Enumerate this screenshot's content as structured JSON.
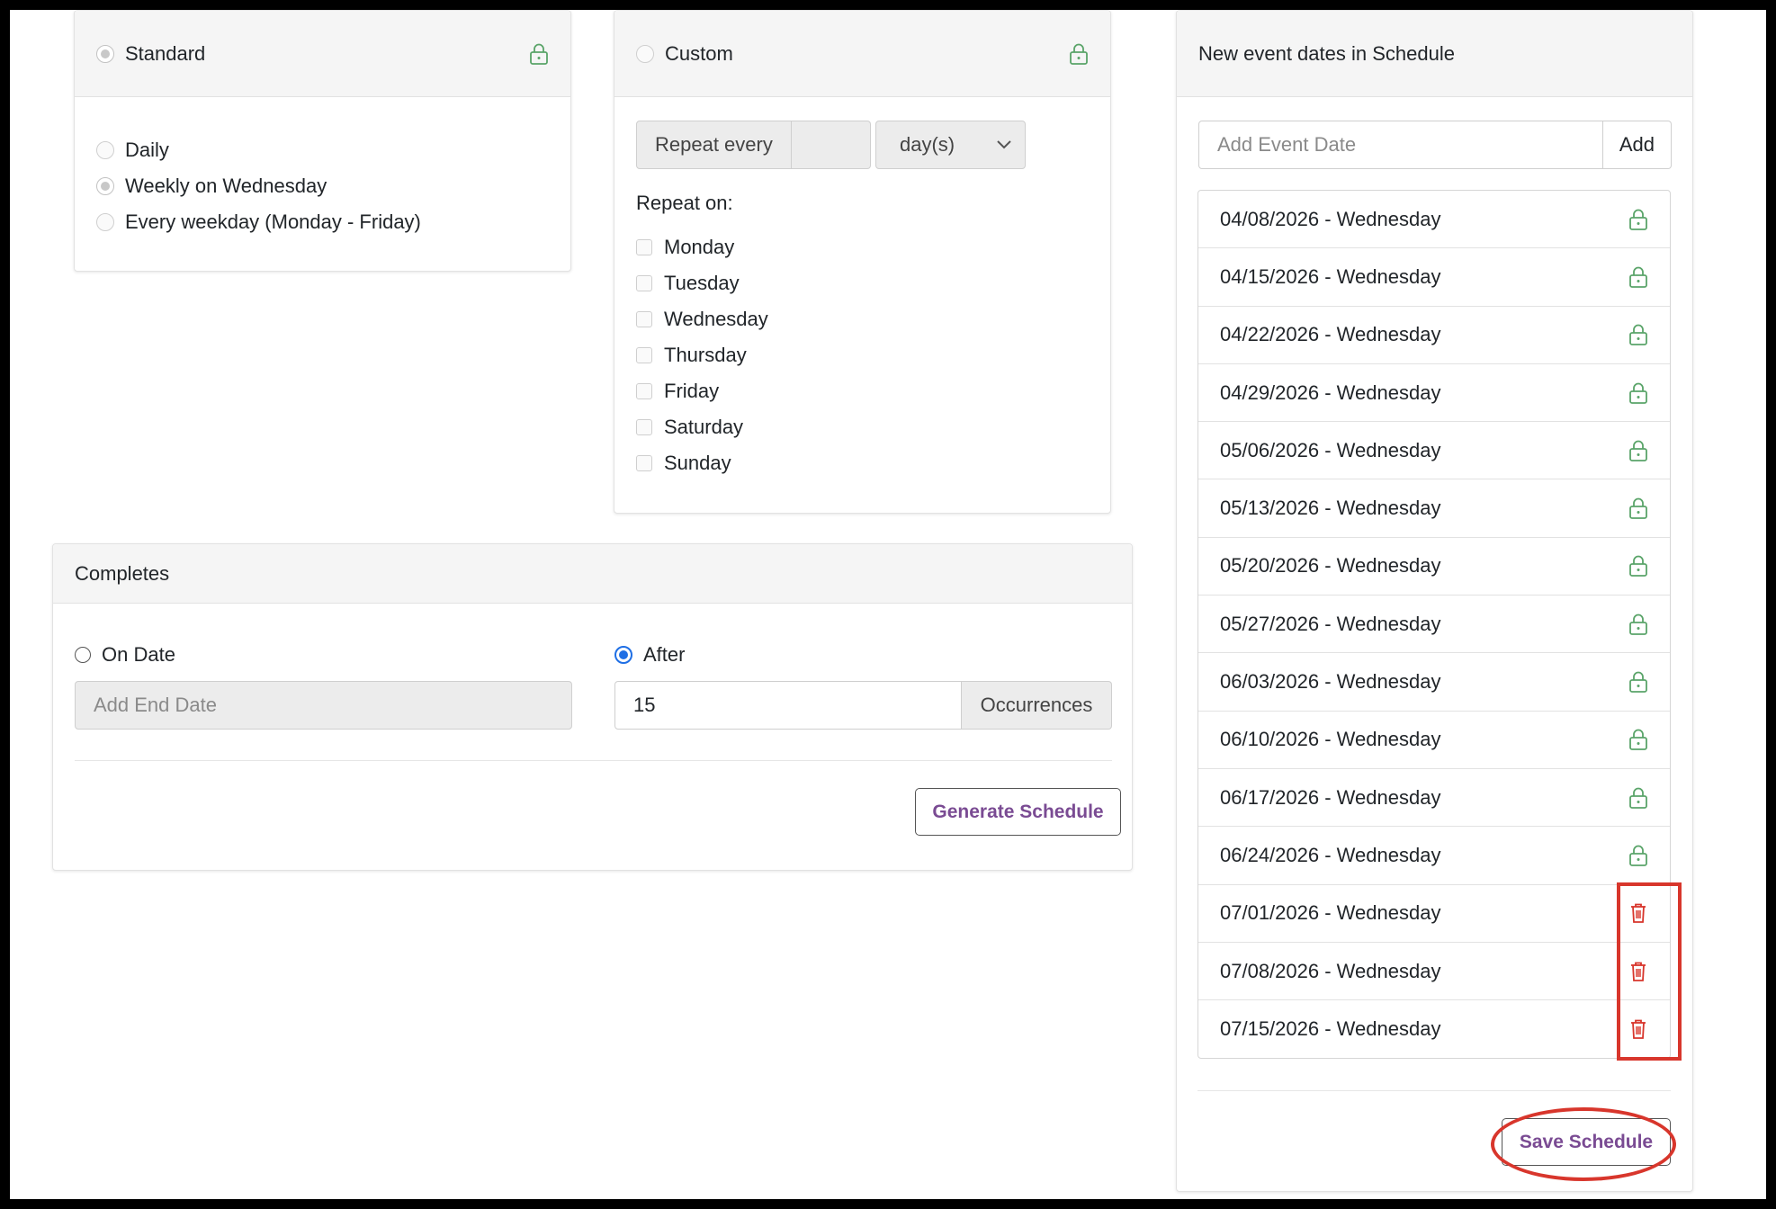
{
  "standard": {
    "title": "Standard",
    "options": [
      {
        "label": "Daily"
      },
      {
        "label": "Weekly on Wednesday"
      },
      {
        "label": "Every weekday (Monday - Friday)"
      }
    ]
  },
  "custom": {
    "title": "Custom",
    "repeat_every_label": "Repeat every",
    "repeat_every_value": "",
    "unit_select": "day(s)",
    "repeat_on_label": "Repeat on:",
    "days": [
      "Monday",
      "Tuesday",
      "Wednesday",
      "Thursday",
      "Friday",
      "Saturday",
      "Sunday"
    ]
  },
  "completes": {
    "title": "Completes",
    "on_date_label": "On Date",
    "end_date_placeholder": "Add End Date",
    "after_label": "After",
    "occurrences_value": "15",
    "occurrences_label": "Occurrences",
    "generate_button": "Generate Schedule"
  },
  "schedule": {
    "title": "New event dates in Schedule",
    "add_placeholder": "Add Event Date",
    "add_button": "Add",
    "dates": [
      {
        "label": "04/08/2026 - Wednesday",
        "icon": "lock"
      },
      {
        "label": "04/15/2026 - Wednesday",
        "icon": "lock"
      },
      {
        "label": "04/22/2026 - Wednesday",
        "icon": "lock"
      },
      {
        "label": "04/29/2026 - Wednesday",
        "icon": "lock"
      },
      {
        "label": "05/06/2026 - Wednesday",
        "icon": "lock"
      },
      {
        "label": "05/13/2026 - Wednesday",
        "icon": "lock"
      },
      {
        "label": "05/20/2026 - Wednesday",
        "icon": "lock"
      },
      {
        "label": "05/27/2026 - Wednesday",
        "icon": "lock"
      },
      {
        "label": "06/03/2026 - Wednesday",
        "icon": "lock"
      },
      {
        "label": "06/10/2026 - Wednesday",
        "icon": "lock"
      },
      {
        "label": "06/17/2026 - Wednesday",
        "icon": "lock"
      },
      {
        "label": "06/24/2026 - Wednesday",
        "icon": "lock"
      },
      {
        "label": "07/01/2026 - Wednesday",
        "icon": "trash"
      },
      {
        "label": "07/08/2026 - Wednesday",
        "icon": "trash"
      },
      {
        "label": "07/15/2026 - Wednesday",
        "icon": "trash"
      }
    ],
    "save_button": "Save Schedule"
  },
  "colors": {
    "lock": "#5aa469",
    "trash": "#d8362c",
    "accent_text": "#7a4b93",
    "radio_selected": "#1f6fe5",
    "annotation": "#d8362c"
  }
}
